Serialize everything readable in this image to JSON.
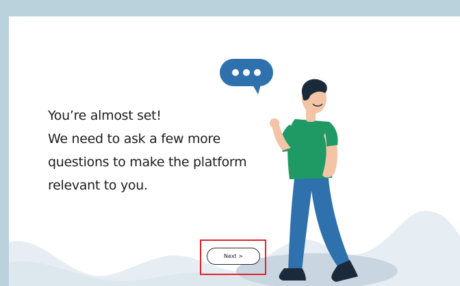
{
  "onboarding": {
    "message_lines": [
      "You’re almost set!",
      "We need to ask a few more",
      "questions to make the platform",
      "relevant to you."
    ],
    "next_label": "Next >"
  },
  "colors": {
    "background": "#b9d2dc",
    "card": "#ffffff",
    "accent_blue": "#2f71ad",
    "shirt_green": "#1f9a64",
    "highlight_red": "#e02127"
  },
  "icons": {
    "speech_bubble": "speech-bubble-ellipsis-icon",
    "person": "person-illustration"
  }
}
